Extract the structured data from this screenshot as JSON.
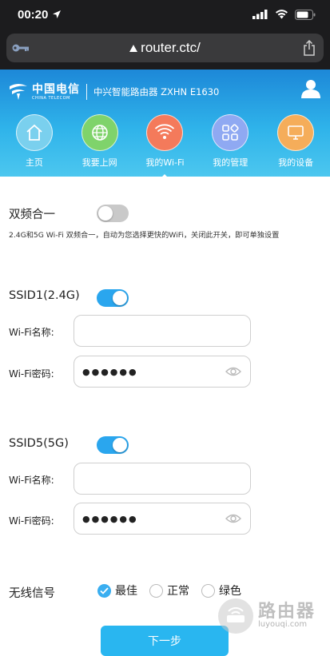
{
  "status_bar": {
    "time": "00:20"
  },
  "browser": {
    "url": "router.ctc/"
  },
  "header": {
    "logo_cn": "中国电信",
    "logo_en": "CHINA TELECOM",
    "product": "中兴智能路由器 ZXHN E1630"
  },
  "nav": {
    "items": [
      {
        "label": "主页",
        "color": "#7ad0ee"
      },
      {
        "label": "我要上网",
        "color": "#7fd36b"
      },
      {
        "label": "我的Wi-Fi",
        "color": "#f47a5b"
      },
      {
        "label": "我的管理",
        "color": "#8fa9f2"
      },
      {
        "label": "我的设备",
        "color": "#f5ad5a"
      }
    ],
    "active_index": 2
  },
  "dual_band": {
    "label": "双频合一",
    "enabled": false,
    "description": "2.4G和5G Wi-Fi 双频合一，自动为您选择更快的WiFi，关闭此开关，即可单独设置"
  },
  "ssid1": {
    "label": "SSID1(2.4G)",
    "enabled": true,
    "name_label": "Wi-Fi名称:",
    "name_value": "",
    "password_label": "Wi-Fi密码:",
    "password_value": "●●●●●●"
  },
  "ssid5": {
    "label": "SSID5(5G)",
    "enabled": true,
    "name_label": "Wi-Fi名称:",
    "name_value": "",
    "password_label": "Wi-Fi密码:",
    "password_value": "●●●●●●"
  },
  "signal": {
    "label": "无线信号",
    "options": [
      {
        "label": "最佳",
        "checked": true
      },
      {
        "label": "正常",
        "checked": false
      },
      {
        "label": "绿色",
        "checked": false
      }
    ]
  },
  "next_button": "下一步",
  "watermark": {
    "cn": "路由器",
    "en": "luyouqi.com"
  },
  "colors": {
    "accent": "#29b6f0",
    "header_top": "#1d88d8",
    "toggle_on": "#2aa6ee"
  }
}
